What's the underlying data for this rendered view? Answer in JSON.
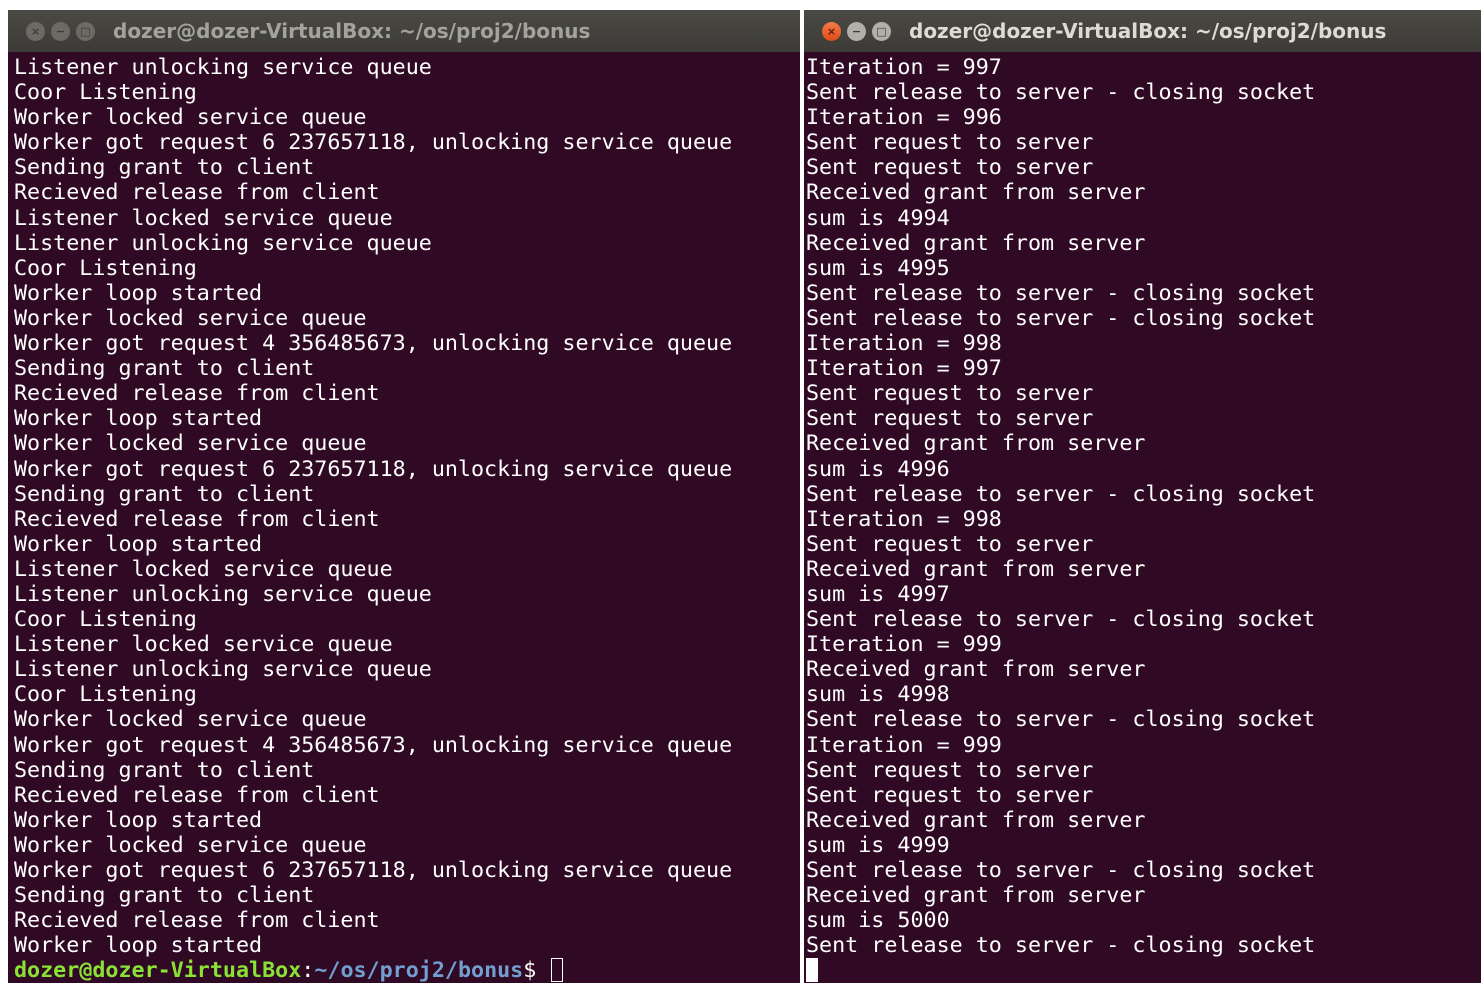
{
  "colors": {
    "terminal_bg": "#300a24",
    "prompt_user": "#8ae234",
    "prompt_path": "#729fcf",
    "close_active": "#df4a16"
  },
  "left_terminal": {
    "title": "dozer@dozer-VirtualBox: ~/os/proj2/bonus",
    "active": false,
    "lines": [
      "Listener unlocking service queue",
      "Coor Listening",
      "Worker locked service queue",
      "Worker got request 6 237657118, unlocking service queue",
      "Sending grant to client",
      "Recieved release from client",
      "Listener locked service queue",
      "Listener unlocking service queue",
      "Coor Listening",
      "Worker loop started",
      "Worker locked service queue",
      "Worker got request 4 356485673, unlocking service queue",
      "Sending grant to client",
      "Recieved release from client",
      "Worker loop started",
      "Worker locked service queue",
      "Worker got request 6 237657118, unlocking service queue",
      "Sending grant to client",
      "Recieved release from client",
      "Worker loop started",
      "Listener locked service queue",
      "Listener unlocking service queue",
      "Coor Listening",
      "Listener locked service queue",
      "Listener unlocking service queue",
      "Coor Listening",
      "Worker locked service queue",
      "Worker got request 4 356485673, unlocking service queue",
      "Sending grant to client",
      "Recieved release from client",
      "Worker loop started",
      "Worker locked service queue",
      "Worker got request 6 237657118, unlocking service queue",
      "Sending grant to client",
      "Recieved release from client",
      "Worker loop started"
    ],
    "prompt": {
      "user": "dozer@dozer-VirtualBox",
      "colon": ":",
      "path": "~/os/proj2/bonus",
      "dollar": "$ "
    }
  },
  "right_terminal": {
    "title": "dozer@dozer-VirtualBox: ~/os/proj2/bonus",
    "active": true,
    "lines": [
      "Iteration = 997",
      "Sent release to server - closing socket",
      "Iteration = 996",
      "Sent request to server",
      "Sent request to server",
      "Received grant from server",
      "sum is 4994",
      "Received grant from server",
      "sum is 4995",
      "Sent release to server - closing socket",
      "Sent release to server - closing socket",
      "Iteration = 998",
      "Iteration = 997",
      "Sent request to server",
      "Sent request to server",
      "Received grant from server",
      "sum is 4996",
      "Sent release to server - closing socket",
      "Iteration = 998",
      "Sent request to server",
      "Received grant from server",
      "sum is 4997",
      "Sent release to server - closing socket",
      "Iteration = 999",
      "Received grant from server",
      "sum is 4998",
      "Sent release to server - closing socket",
      "Iteration = 999",
      "Sent request to server",
      "Sent request to server",
      "Received grant from server",
      "sum is 4999",
      "Sent release to server - closing socket",
      "Received grant from server",
      "sum is 5000",
      "Sent release to server - closing socket"
    ]
  }
}
